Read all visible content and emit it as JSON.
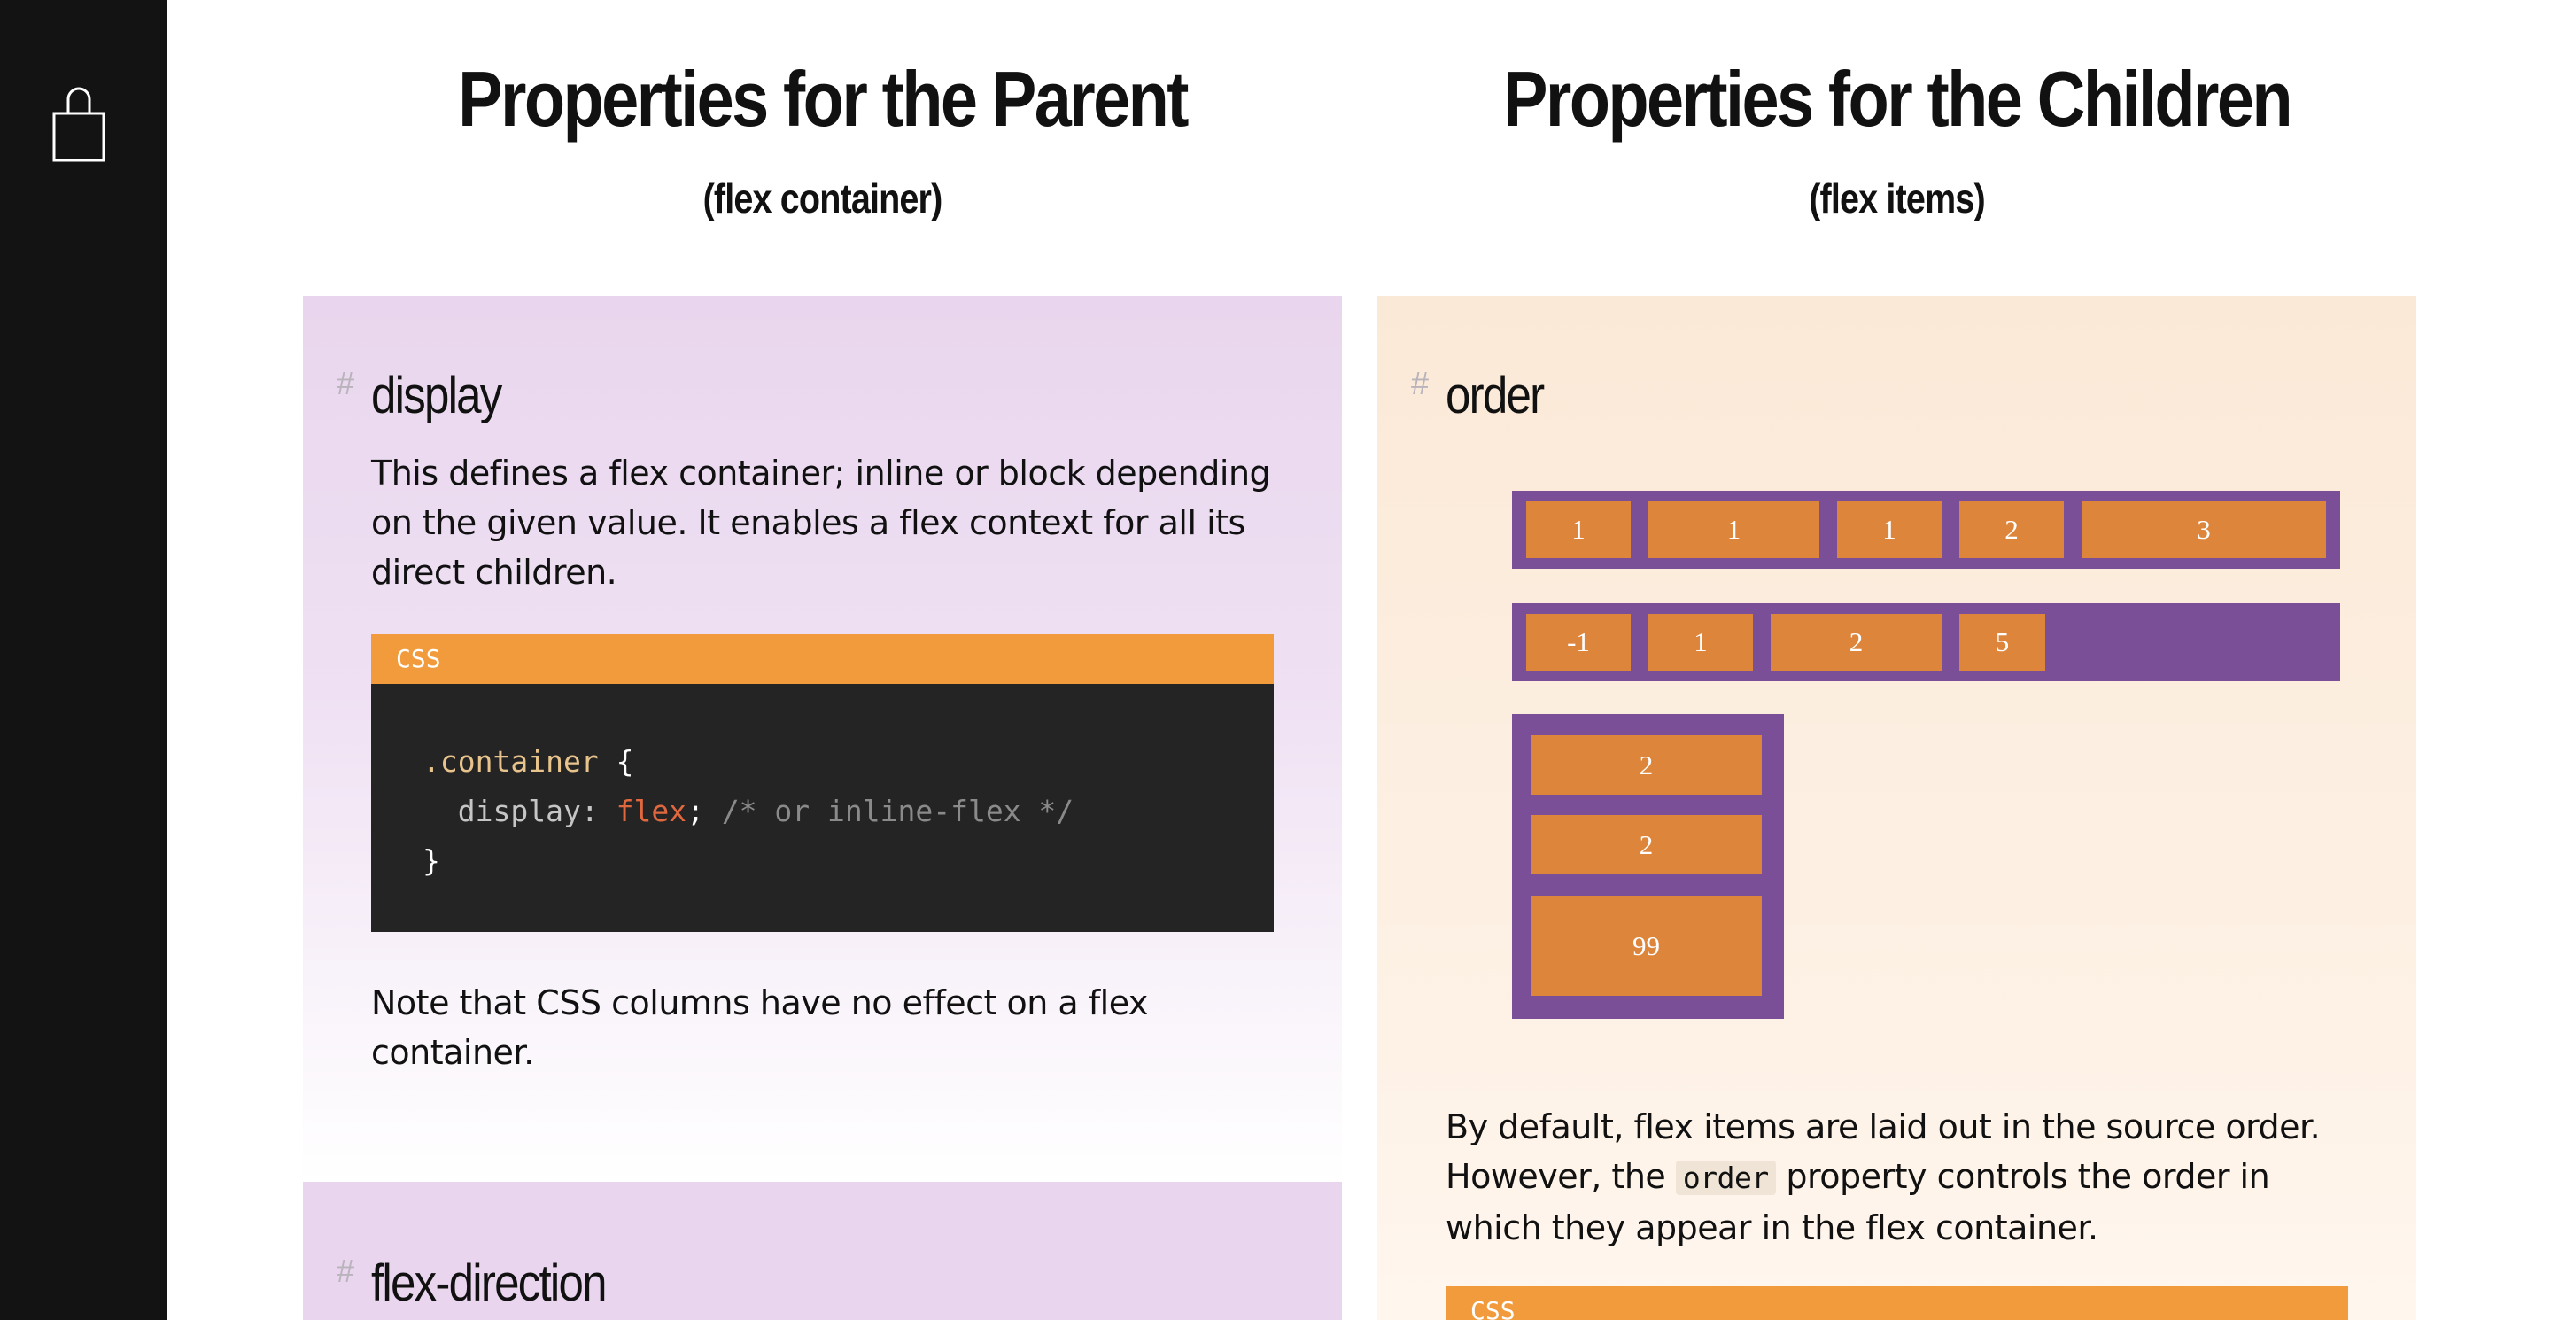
{
  "sidebar": {
    "icon": "shopping-bag-icon"
  },
  "headings": {
    "parent": {
      "title": "Properties for the Parent",
      "subtitle": "(flex container)"
    },
    "children": {
      "title": "Properties for the Children",
      "subtitle": "(flex items)"
    }
  },
  "display_section": {
    "hash": "#",
    "title": "display",
    "description": "This defines a flex container; inline or block depending on the given value. It enables a flex context for all its direct children.",
    "code_label": "CSS",
    "code": {
      "selector": ".container",
      "open_brace": "{",
      "property": "display",
      "colon": ":",
      "value": "flex",
      "semicolon": ";",
      "comment": "/* or inline-flex */",
      "close_brace": "}"
    },
    "note": "Note that CSS columns have no effect on a flex container."
  },
  "flex_direction_section": {
    "hash": "#",
    "title": "flex-direction"
  },
  "order_section": {
    "hash": "#",
    "title": "order",
    "demo_row1": [
      "1",
      "1",
      "1",
      "2",
      "3"
    ],
    "demo_row2": [
      "-1",
      "1",
      "2",
      "5"
    ],
    "demo_column": [
      "2",
      "2",
      "99"
    ],
    "description_part1": "By default, flex items are laid out in the source order. However, the",
    "description_code": "order",
    "description_part2": "property controls the order in which they appear in the flex container.",
    "code_label": "CSS"
  },
  "colors": {
    "sidebar": "#131313",
    "parent_panel": "#e9d6ee",
    "children_panel": "#fbe9d7",
    "code_header": "#f19b3c",
    "code_body": "#242424",
    "flex_container": "#7b4f97",
    "flex_item": "#de853c"
  }
}
